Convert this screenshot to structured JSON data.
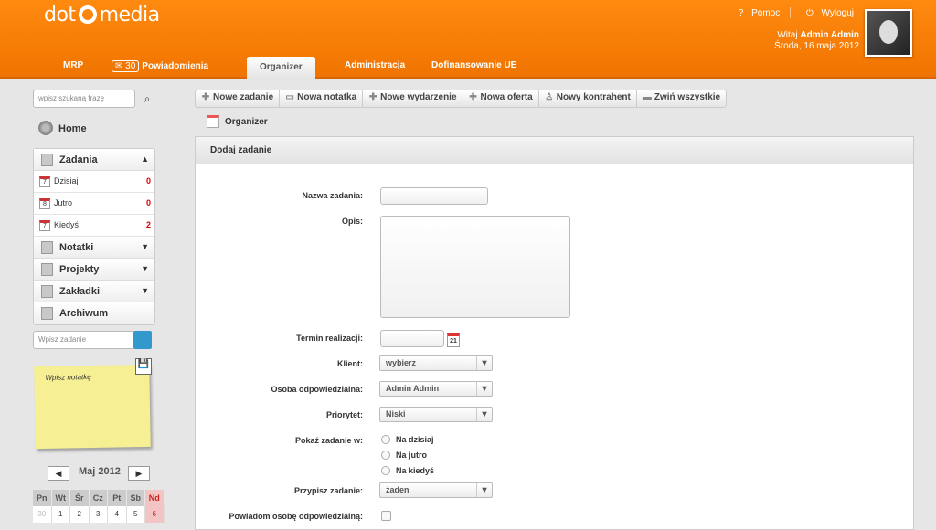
{
  "app": {
    "logo_left": "dot",
    "logo_right": "media"
  },
  "top_links": {
    "help": "Pomoc",
    "logout": "Wyloguj"
  },
  "user": {
    "welcome_prefix": "Witaj",
    "name": "Admin Admin",
    "date": "Środa, 16 maja 2012"
  },
  "nav": {
    "tabs": [
      {
        "label": "MRP"
      },
      {
        "label": "Powiadomienia",
        "badge": "30"
      },
      {
        "label": "Organizer"
      },
      {
        "label": "Administracja"
      },
      {
        "label": "Dofinansowanie UE"
      }
    ]
  },
  "sidebar": {
    "search_placeholder": "wpisz szukaną frazę",
    "home": "Home",
    "menu": {
      "zadania": "Zadania",
      "subs": [
        {
          "label": "Dzisiaj",
          "count": "0",
          "day": "7"
        },
        {
          "label": "Jutro",
          "count": "0",
          "day": "8"
        },
        {
          "label": "Kiedyś",
          "count": "2",
          "day": "7"
        }
      ],
      "notatki": "Notatki",
      "projekty": "Projekty",
      "zakladki": "Zakładki",
      "archiwum": "Archiwum"
    },
    "quick_task_placeholder": "Wpisz zadanie",
    "note_placeholder": "Wpisz notatkę",
    "calendar": {
      "month": "Maj 2012",
      "days": [
        "Pn",
        "Wt",
        "Śr",
        "Cz",
        "Pt",
        "Sb",
        "Nd"
      ],
      "row1": [
        "30",
        "1",
        "2",
        "3",
        "4",
        "5",
        "6"
      ]
    }
  },
  "toolbar": {
    "new_task": "Nowe zadanie",
    "new_note": "Nowa notatka",
    "new_event": "Nowe wydarzenie",
    "new_offer": "Nowa oferta",
    "new_contractor": "Nowy kontrahent",
    "collapse_all": "Zwiń wszystkie"
  },
  "breadcrumb": "Organizer",
  "form": {
    "title": "Dodaj zadanie",
    "task_name_label": "Nazwa zadania:",
    "description_label": "Opis:",
    "deadline_label": "Termin realizacji:",
    "client_label": "Klient:",
    "client_value": "wybierz",
    "responsible_label": "Osoba odpowiedzialna:",
    "responsible_value": "Admin Admin",
    "priority_label": "Priorytet:",
    "priority_value": "Niski",
    "show_in_label": "Pokaż zadanie w:",
    "show_options": [
      "Na dzisiaj",
      "Na jutro",
      "Na kiedyś"
    ],
    "assign_label": "Przypisz zadanie:",
    "assign_value": "żaden",
    "notify_label": "Powiadom osobę odpowiedzialną:",
    "date_icon_month": "Apr",
    "date_icon_day": "21"
  }
}
